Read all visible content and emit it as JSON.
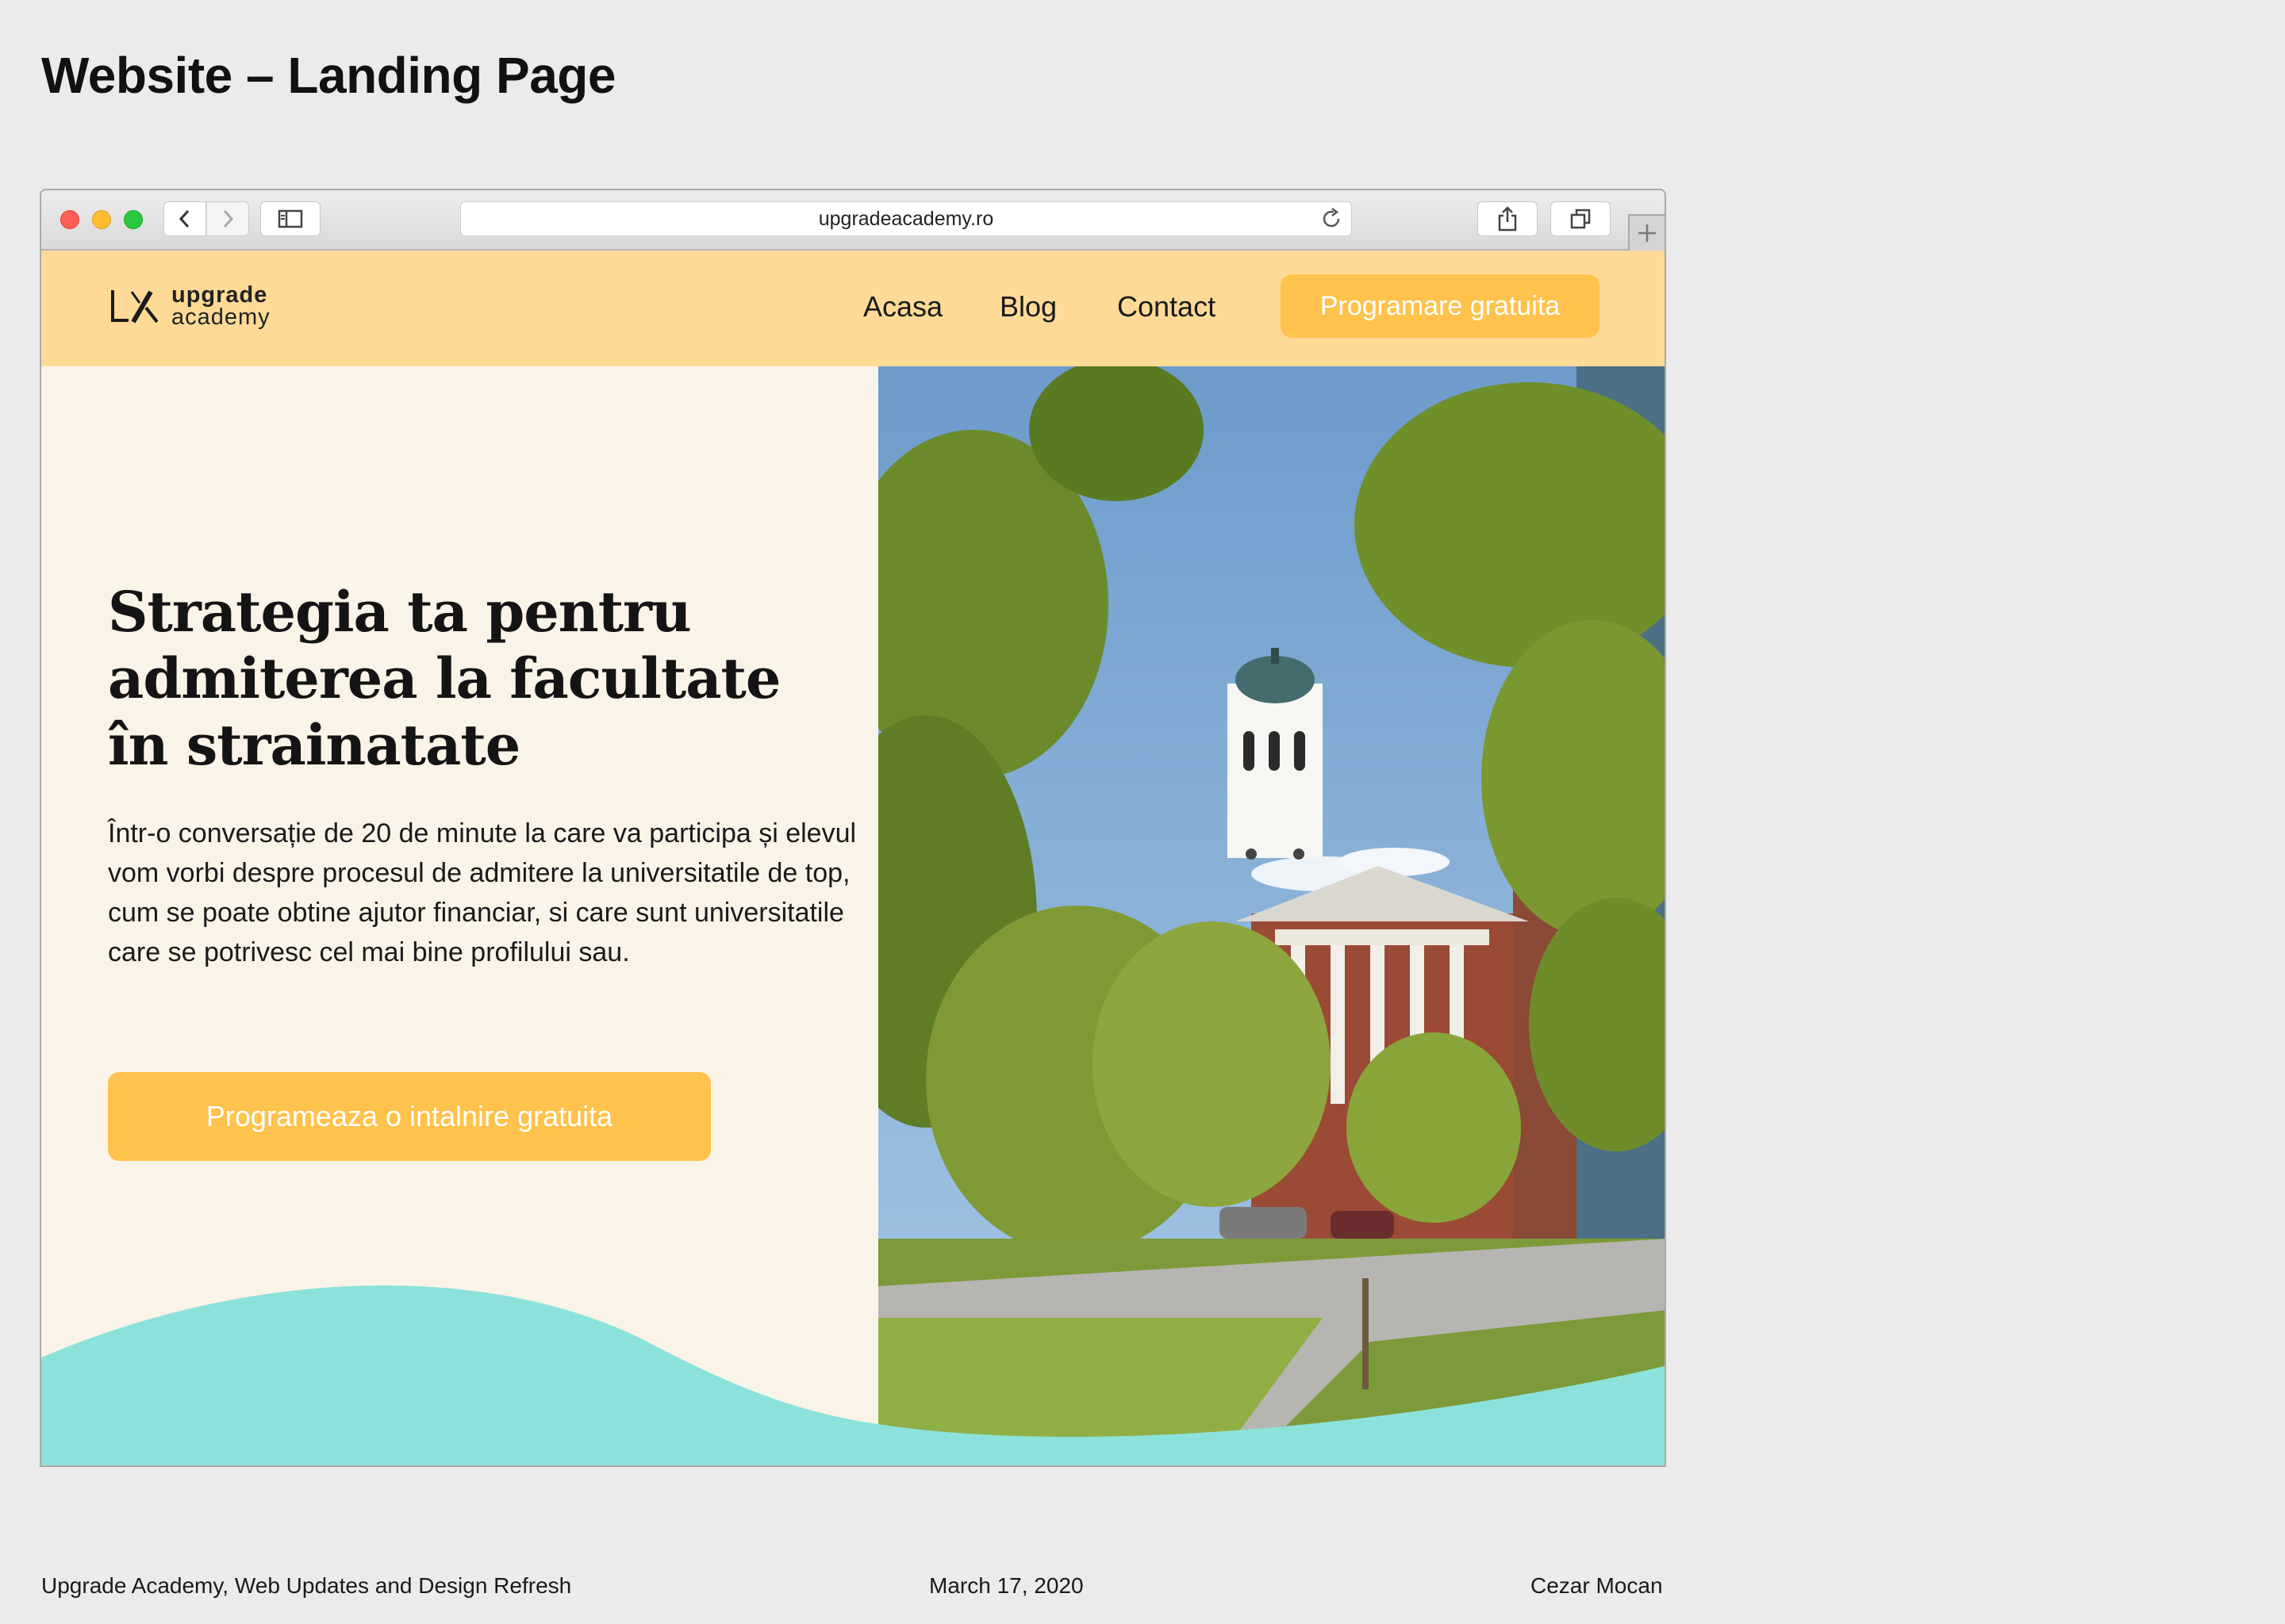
{
  "page_title": "Website – Landing Page",
  "browser": {
    "url": "upgradeacademy.ro"
  },
  "site": {
    "logo": {
      "line1": "upgrade",
      "line2": "academy"
    },
    "nav": {
      "home": "Acasa",
      "blog": "Blog",
      "contact": "Contact"
    },
    "header_cta": "Programare gratuita",
    "hero": {
      "title_line1": "Strategia ta pentru",
      "title_line2": "admiterea la facultate",
      "title_line3": "în strainatate",
      "description": "Într-o conversație de 20 de minute la care va participa și elevul vom vorbi despre procesul de admitere la universitatile de top, cum se poate obtine ajutor financiar, si care sunt universitatile care se potrivesc cel mai bine profilului sau.",
      "cta": "Programeaza o intalnire gratuita"
    },
    "colors": {
      "header_bg": "#ffda97",
      "accent": "#ffc24c",
      "hero_bg": "#faf3e7",
      "wave": "#8ce2db"
    }
  },
  "footer": {
    "project": "Upgrade Academy, Web Updates and Design Refresh",
    "date": "March 17, 2020",
    "author": "Cezar Mocan"
  }
}
